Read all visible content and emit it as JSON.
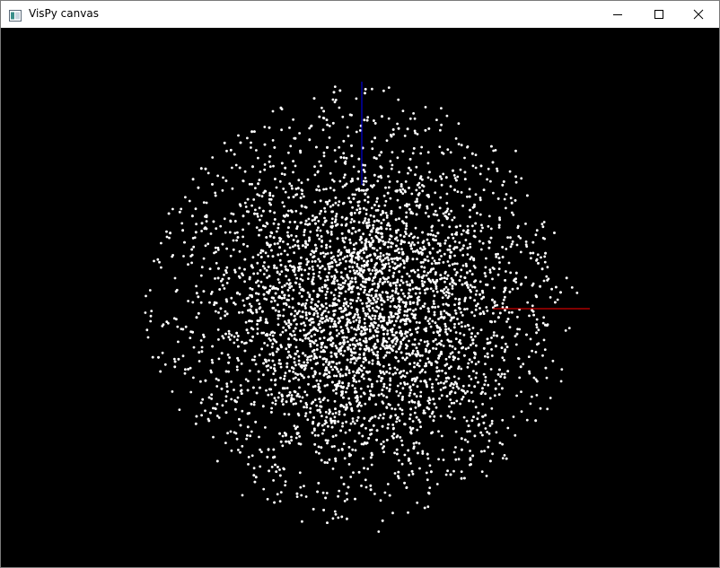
{
  "window": {
    "title": "VisPy canvas",
    "app_icon": "vispy-app-icon",
    "controls": {
      "minimize_icon": "minimize-icon",
      "maximize_icon": "maximize-icon",
      "close_icon": "close-icon"
    }
  },
  "canvas": {
    "background": "#000000",
    "point_color": "#ffffff",
    "axis_colors": {
      "x": "#ff0000",
      "z": "#0000ff"
    }
  }
}
